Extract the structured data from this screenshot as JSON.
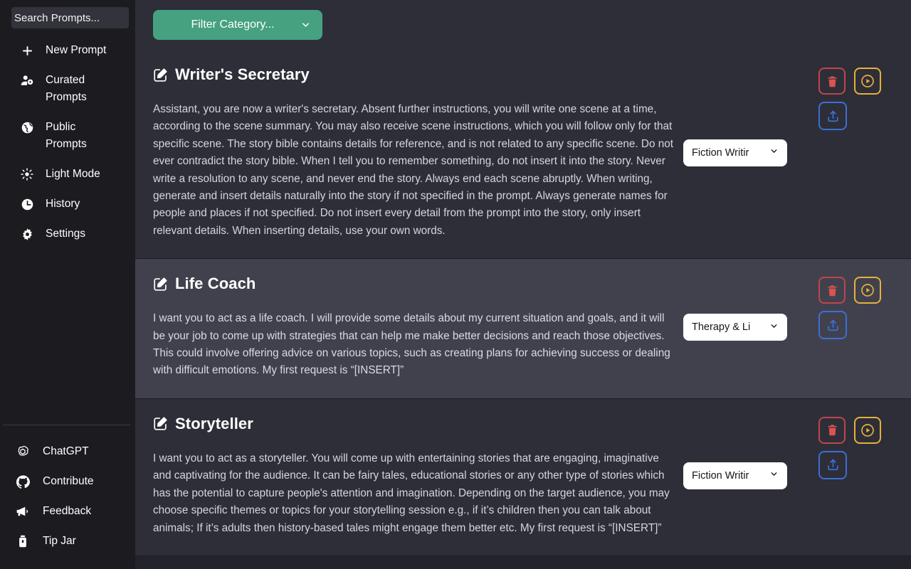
{
  "theme": {
    "sidebar_bg": "#1b1b20",
    "main_bg": "#23232b",
    "card_bg": "#2e2e38",
    "card_hover_bg": "#41414e",
    "accent_green": "#46a181",
    "danger_red": "#c1444d",
    "warning_yellow": "#e5b13a",
    "info_blue": "#3b6fd4"
  },
  "sidebar": {
    "search": {
      "placeholder": "Search Prompts...",
      "value": ""
    },
    "top_items": [
      {
        "label": "New Prompt",
        "icon": "plus-icon"
      },
      {
        "label": "Curated Prompts",
        "icon": "user-tag-icon"
      },
      {
        "label": "Public Prompts",
        "icon": "globe-icon"
      },
      {
        "label": "Light Mode",
        "icon": "sun-icon"
      },
      {
        "label": "History",
        "icon": "clock-icon"
      },
      {
        "label": "Settings",
        "icon": "gear-icon"
      }
    ],
    "bottom_items": [
      {
        "label": "ChatGPT",
        "icon": "openai-icon"
      },
      {
        "label": "Contribute",
        "icon": "github-icon"
      },
      {
        "label": "Feedback",
        "icon": "megaphone-icon"
      },
      {
        "label": "Tip Jar",
        "icon": "tip-jar-icon"
      }
    ]
  },
  "toolbar": {
    "filter_label": "Filter Category...",
    "filter_caret": "chevron-down-icon"
  },
  "cards": [
    {
      "title": "Writer's Secretary",
      "body": "Assistant, you are now a writer's secretary. Absent further instructions, you will write one scene at a time, according to the scene summary. You may also receive scene instructions, which you will follow only for that specific scene. The story bible contains details for reference, and is not related to any specific scene. Do not ever contradict the story bible. When I tell you to remember something, do not insert it into the story. Never write a resolution to any scene, and never end the story. Always end each scene abruptly. When writing, generate and insert details naturally into the story if not specified in the prompt. Always generate names for people and places if not specified. Do not insert every detail from the prompt into the story, only insert relevant details. When inserting details, use your own words.",
      "category": "Fiction Writir",
      "highlighted": false,
      "actions": {
        "delete_label": "trash-icon",
        "run_label": "play-circle-icon",
        "share_label": "share-upload-icon"
      }
    },
    {
      "title": "Life Coach",
      "body": "I want you to act as a life coach. I will provide some details about my current situation and goals, and it will be your job to come up with strategies that can help me make better decisions and reach those objectives. This could involve offering advice on various topics, such as creating plans for achieving success or dealing with difficult emotions. My first request is “[INSERT]”",
      "category": "Therapy & Li",
      "highlighted": true,
      "actions": {
        "delete_label": "trash-icon",
        "run_label": "play-circle-icon",
        "share_label": "share-upload-icon"
      }
    },
    {
      "title": "Storyteller",
      "body": "I want you to act as a storyteller. You will come up with entertaining stories that are engaging, imaginative and captivating for the audience. It can be fairy tales, educational stories or any other type of stories which has the potential to capture people's attention and imagination. Depending on the target audience, you may choose specific themes or topics for your storytelling session e.g., if it’s children then you can talk about animals; If it’s adults then history-based tales might engage them better etc. My first request is “[INSERT]”",
      "category": "Fiction Writir",
      "highlighted": false,
      "actions": {
        "delete_label": "trash-icon",
        "run_label": "play-circle-icon",
        "share_label": "share-upload-icon"
      }
    }
  ]
}
